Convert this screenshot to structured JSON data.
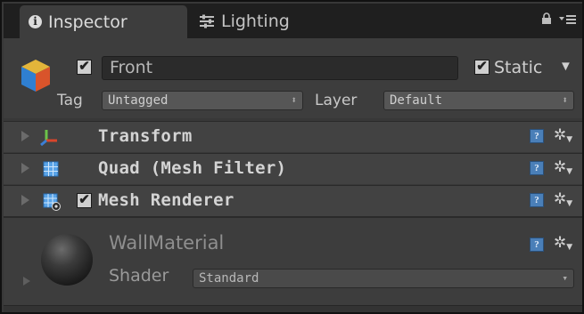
{
  "tabs": [
    {
      "label": "Inspector",
      "icon": "info-icon",
      "active": true
    },
    {
      "label": "Lighting",
      "icon": "lighting-sliders-icon",
      "active": false
    }
  ],
  "header": {
    "object_name": "Front",
    "active_checked": true,
    "static_label": "Static",
    "static_checked": true,
    "tag_label": "Tag",
    "tag_value": "Untagged",
    "layer_label": "Layer",
    "layer_value": "Default"
  },
  "components": [
    {
      "title": "Transform",
      "icon": "transform-axes-icon"
    },
    {
      "title": "Quad (Mesh Filter)",
      "icon": "mesh-filter-grid-icon"
    },
    {
      "title": "Mesh Renderer",
      "icon": "mesh-renderer-icon",
      "enabled": true
    }
  ],
  "material": {
    "name": "WallMaterial",
    "shader_label": "Shader",
    "shader_value": "Standard"
  },
  "colors": {
    "panel": "#3d3d3d",
    "tabbar": "#1f1f1f",
    "help_blue": "#4a7fb8"
  }
}
